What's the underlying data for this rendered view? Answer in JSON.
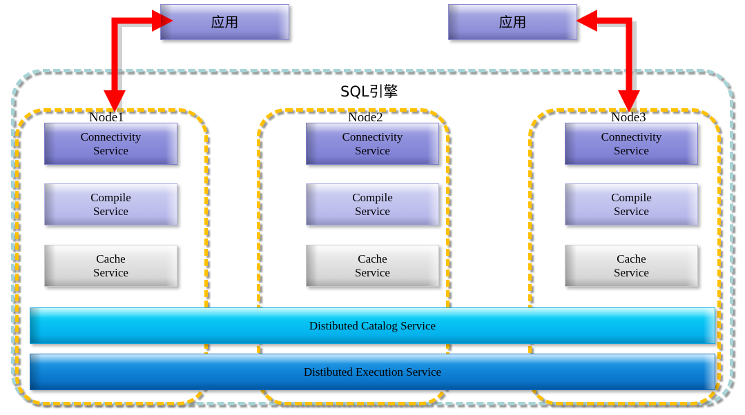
{
  "diagram": {
    "title_overlay": "SQL引擎",
    "outer_container_label": "SQL引擎",
    "apps": [
      {
        "id": "app-left",
        "label": "应用"
      },
      {
        "id": "app-right",
        "label": "应用"
      }
    ],
    "nodes": [
      {
        "id": "node1",
        "label": "Node1",
        "services": [
          {
            "id": "connectivity",
            "label": "Connectivity\nService"
          },
          {
            "id": "compile",
            "label": "Compile\nService"
          },
          {
            "id": "cache",
            "label": "Cache\nService"
          }
        ]
      },
      {
        "id": "node2",
        "label": "Node2",
        "services": [
          {
            "id": "connectivity",
            "label": "Connectivity\nService"
          },
          {
            "id": "compile",
            "label": "Compile\nService"
          },
          {
            "id": "cache",
            "label": "Cache\nService"
          }
        ]
      },
      {
        "id": "node3",
        "label": "Node3",
        "services": [
          {
            "id": "connectivity",
            "label": "Connectivity\nService"
          },
          {
            "id": "compile",
            "label": "Compile\nService"
          },
          {
            "id": "cache",
            "label": "Cache\nService"
          }
        ]
      }
    ],
    "shared_bars": [
      {
        "id": "catalog",
        "label": "Distibuted Catalog Service"
      },
      {
        "id": "execution",
        "label": "Distibuted Execution Service"
      }
    ],
    "connectors": [
      {
        "id": "app-left-to-node1",
        "from": "node1",
        "to": "app-left",
        "style": "double-headed-elbow"
      },
      {
        "id": "app-right-to-node3",
        "from": "node3",
        "to": "app-right",
        "style": "double-headed-elbow"
      }
    ],
    "colors": {
      "arrow": "#ff0000",
      "outer_dash": "#a6d3d6",
      "node_dash": "#ffc000",
      "app_fill": "#8f90dc",
      "connectivity_fill": "#7a7bd2",
      "compile_fill": "#b0b1e8",
      "cache_fill": "#d8d8d8",
      "catalog_fill": "#07c3f3",
      "execution_fill": "#1186d8",
      "text": "#000000"
    }
  }
}
